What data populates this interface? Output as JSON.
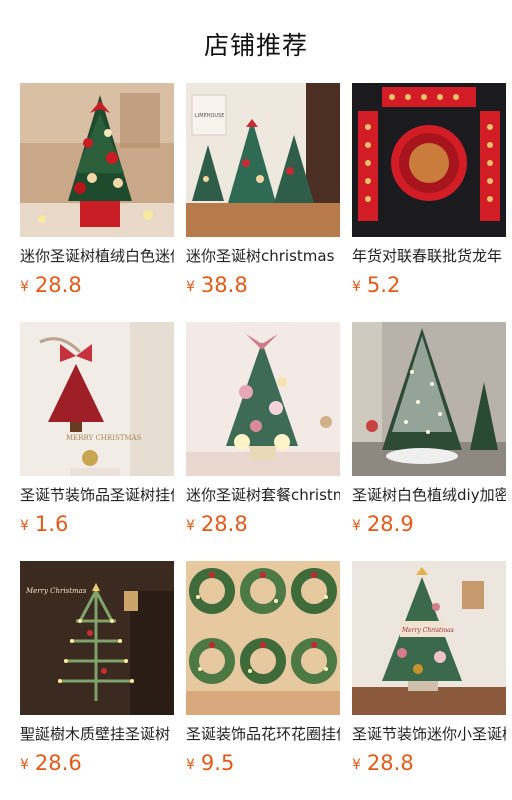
{
  "header": {
    "title": "店铺推荐"
  },
  "currency": "¥",
  "products": [
    {
      "name": "迷你圣诞树植绒白色迷你",
      "price": "28.8",
      "image": "mini-christmas-tree-red-photo"
    },
    {
      "name": "迷你圣诞树christmas",
      "price": "38.8",
      "image": "mini-christmas-trees-trio-photo"
    },
    {
      "name": "年货对联春联批货龙年",
      "price": "5.2",
      "image": "spring-festival-couplets-photo"
    },
    {
      "name": "圣诞节装饰品圣诞树挂件",
      "price": "1.6",
      "image": "christmas-tree-hanging-ornament-photo"
    },
    {
      "name": "迷你圣诞树套餐christmas",
      "price": "28.8",
      "image": "mini-christmas-tree-set-photo"
    },
    {
      "name": "圣诞树白色植绒diy加密",
      "price": "28.9",
      "image": "white-flocked-christmas-tree-photo"
    },
    {
      "name": "聖誕樹木质壁挂圣诞树",
      "price": "28.6",
      "image": "wall-christmas-tree-lights-photo"
    },
    {
      "name": "圣诞装饰品花环花圈挂件",
      "price": "9.5",
      "image": "christmas-wreaths-grid-photo"
    },
    {
      "name": "圣诞节装饰迷你小圣诞树",
      "price": "28.8",
      "image": "small-christmas-tree-desk-photo"
    }
  ],
  "image_texts": {
    "banner_merry": "MERRY CHRISTMAS",
    "wall_sign": "Merry Christmas",
    "bag_text": "LIMEHOUSE",
    "tree_sign": "Merry Christmas"
  }
}
